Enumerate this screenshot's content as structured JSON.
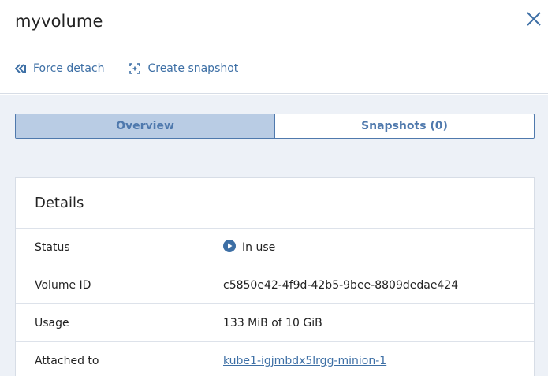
{
  "header": {
    "title": "myvolume",
    "close_icon": "close-icon"
  },
  "toolbar": {
    "force_detach_label": "Force detach",
    "force_detach_icon": "force-detach-icon",
    "create_snapshot_label": "Create snapshot",
    "create_snapshot_icon": "snapshot-icon"
  },
  "tabs": [
    {
      "label": "Overview",
      "active": true
    },
    {
      "label": "Snapshots (0)",
      "active": false
    }
  ],
  "details": {
    "title": "Details",
    "rows": [
      {
        "label": "Status",
        "value": "In use",
        "icon": "play-circle-icon"
      },
      {
        "label": "Volume ID",
        "value": "c5850e42-4f9d-42b5-9bee-8809dedae424"
      },
      {
        "label": "Usage",
        "value": "133 MiB of 10 GiB"
      },
      {
        "label": "Attached to",
        "value": "kube1-igjmbdx5lrgg-minion-1",
        "link": true
      }
    ]
  },
  "colors": {
    "accent": "#3d6fa5",
    "tab_border": "#4f79ad",
    "tab_active_bg": "#b9cce4",
    "background_gray": "#edf1f7"
  }
}
